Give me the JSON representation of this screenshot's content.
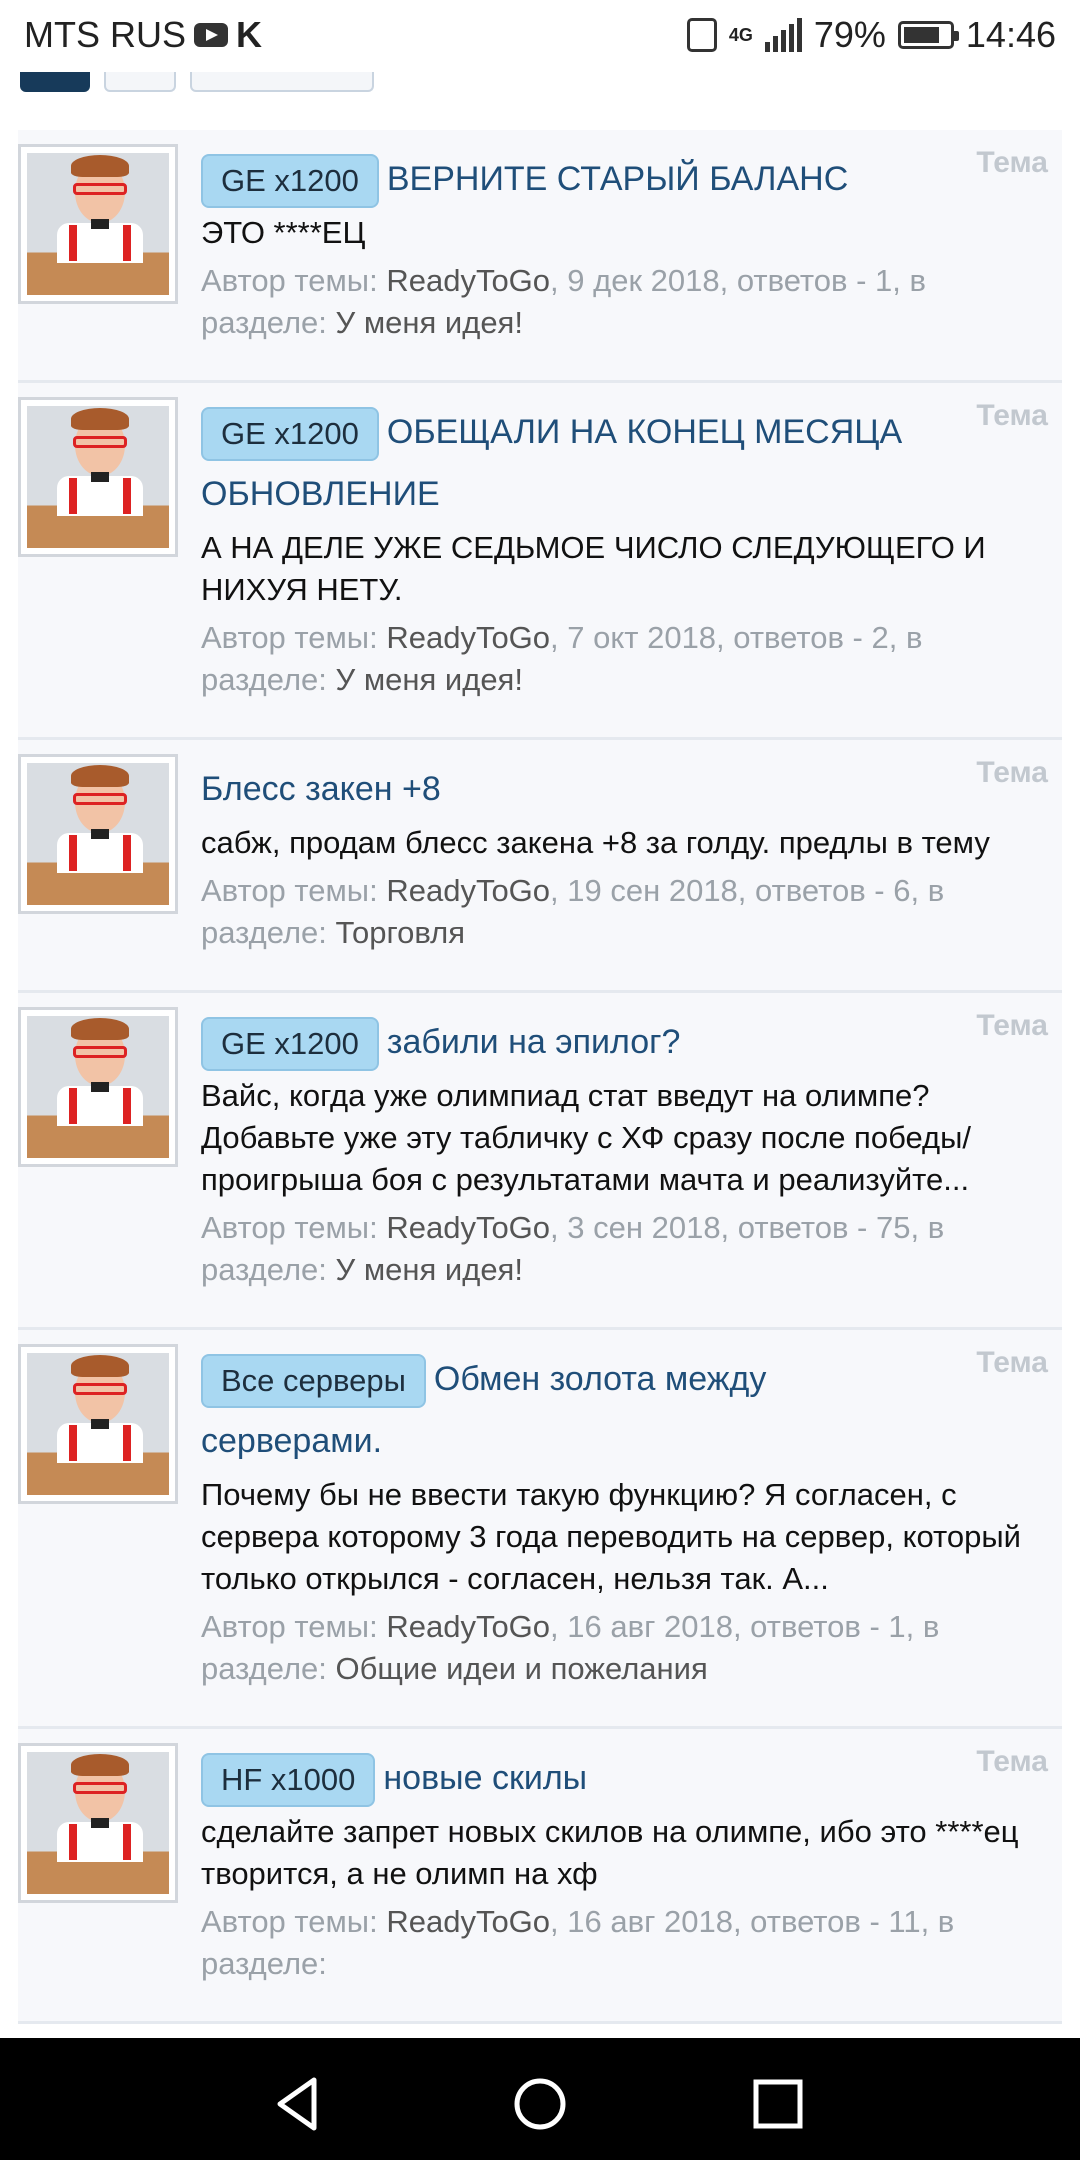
{
  "status_bar": {
    "carrier": "MTS RUS",
    "network": "4G",
    "battery": "79%",
    "battery_level": 0.79,
    "time": "14:46"
  },
  "topics": [
    {
      "badge": "GE x1200",
      "title": "ВЕРНИТЕ СТАРЫЙ БАЛАНС",
      "excerpt": "ЭТО ****ЕЦ",
      "type": "Тема",
      "meta_author_label": "Автор темы: ",
      "author": "ReadyToGo",
      "meta_info": ", 9 дек 2018, ответов - 1, в",
      "section_label": "разделе: ",
      "section": "У меня идея!"
    },
    {
      "badge": "GE x1200",
      "title": "ОБЕЩАЛИ НА КОНЕЦ МЕСЯЦА ОБНОВЛЕНИЕ",
      "excerpt": "А НА ДЕЛЕ УЖЕ СЕДЬМОЕ ЧИСЛО СЛЕДУЮЩЕГО И НИХУЯ НЕТУ.",
      "type": "Тема",
      "meta_author_label": "Автор темы: ",
      "author": "ReadyToGo",
      "meta_info": ", 7 окт 2018, ответов - 2, в",
      "section_label": "разделе: ",
      "section": "У меня идея!"
    },
    {
      "badge": "",
      "title": "Блесс закен +8",
      "excerpt": "сабж, продам блесс закена +8 за голду. предлы в тему",
      "type": "Тема",
      "meta_author_label": "Автор темы: ",
      "author": "ReadyToGo",
      "meta_info": ", 19 сен 2018, ответов - 6, в",
      "section_label": "разделе: ",
      "section": "Торговля"
    },
    {
      "badge": "GE x1200",
      "title": "забили на эпилог?",
      "excerpt": "Вайс, когда уже олимпиад стат введут на олимпе? Добавьте уже эту табличку с ХФ сразу после победы/проигрыша боя с результатами мачта и реализуйте...",
      "type": "Тема",
      "meta_author_label": "Автор темы: ",
      "author": "ReadyToGo",
      "meta_info": ", 3 сен 2018, ответов - 75, в",
      "section_label": "разделе: ",
      "section": "У меня идея!"
    },
    {
      "badge": "Все серверы",
      "title": "Обмен золота между серверами.",
      "excerpt": "Почему бы не ввести такую функцию? Я согласен, с сервера которому 3 года переводить на сервер, который только открылся - согласен, нельзя так. А...",
      "type": "Тема",
      "meta_author_label": "Автор темы: ",
      "author": "ReadyToGo",
      "meta_info": ", 16 авг 2018, ответов - 1, в",
      "section_label": "разделе: ",
      "section": "Общие идеи и пожелания"
    },
    {
      "badge": "HF x1000",
      "title": "новые скилы",
      "excerpt": "сделайте запрет новых скилов на олимпе, ибо это ****ец творится, а не олимп на хф",
      "type": "Тема",
      "meta_author_label": "Автор темы: ",
      "author": "ReadyToGo",
      "meta_info": ", 16 авг 2018, ответов - 11, в",
      "section_label": "разделе: ",
      "section": ""
    }
  ]
}
